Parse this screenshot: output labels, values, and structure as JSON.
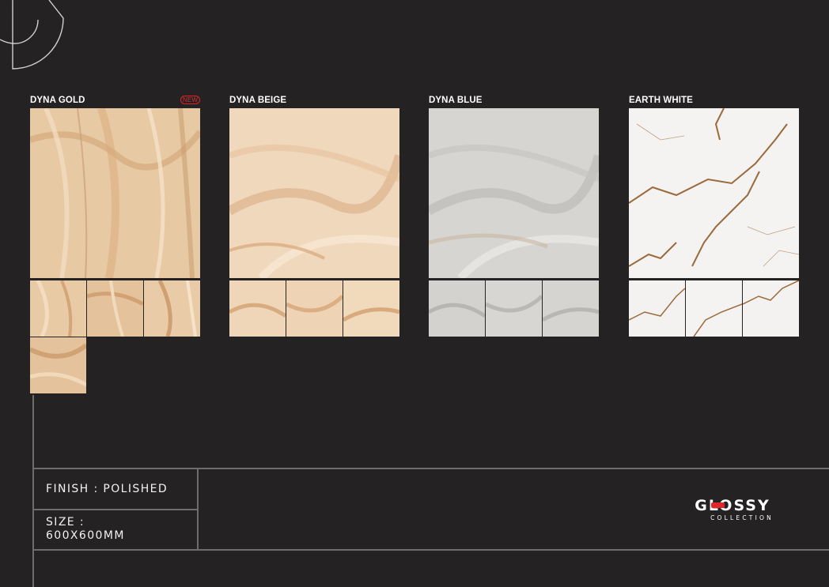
{
  "products": [
    {
      "name": "DYNA GOLD",
      "badge": "NEW",
      "palette": "gold"
    },
    {
      "name": "DYNA BEIGE",
      "badge": "",
      "palette": "beige"
    },
    {
      "name": "DYNA BLUE",
      "badge": "",
      "palette": "blue"
    },
    {
      "name": "EARTH WHITE",
      "badge": "",
      "palette": "white"
    }
  ],
  "specs": {
    "finish": "FINISH : POLISHED",
    "size_label": "SIZE :",
    "size_value": "600X600MM"
  },
  "brand": {
    "name": "GLOSSY",
    "tagline": "COLLECTION",
    "accent": "#e1262b"
  },
  "colors": {
    "background": "#242222",
    "frame": "#6e6c6c"
  }
}
